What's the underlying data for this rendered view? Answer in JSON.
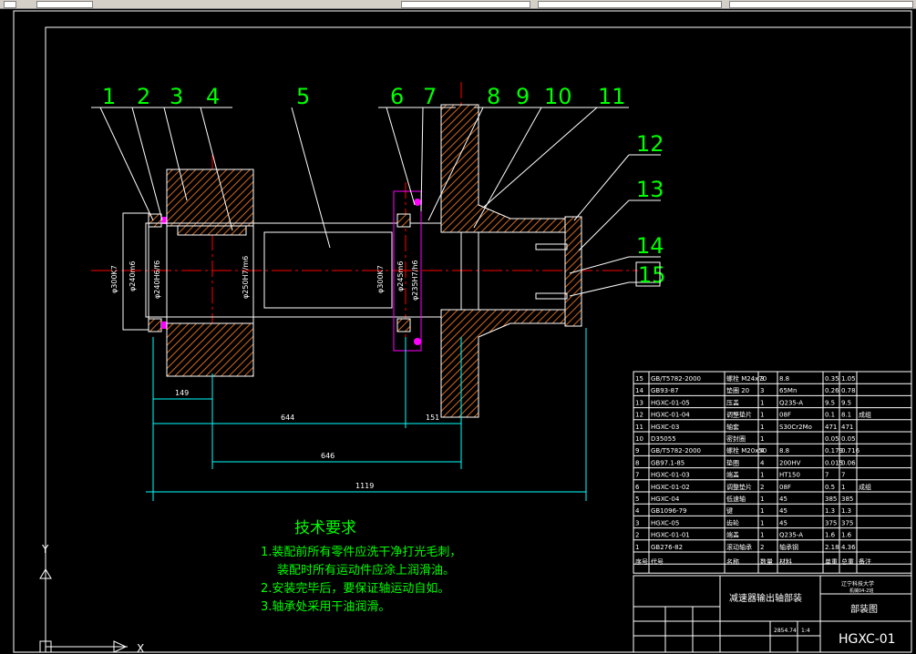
{
  "colors": {
    "background": "#000000",
    "frame": "#ffffff",
    "part_hatch": "#d2691e",
    "part_fill": "#d2691e",
    "centerline": "#ff0000",
    "leader": "#00ffff",
    "balloon": "#00ff00",
    "dim": "#00ffff",
    "seal": "#ff00ff",
    "text": "#00ff00",
    "table": "#ffffff"
  },
  "balloons": [
    "1",
    "2",
    "3",
    "4",
    "5",
    "6",
    "7",
    "8",
    "9",
    "10",
    "11",
    "12",
    "13",
    "14",
    "15"
  ],
  "fit_labels": {
    "d1": "φ300K7",
    "d2": "φ240m6",
    "d3": "φ240H6/f6",
    "d4": "φ250H7/m6",
    "d5": "φ300K7",
    "d6": "φ245m6",
    "d7": "φ235H7/h6"
  },
  "dimensions": {
    "d149": "149",
    "d644": "644",
    "d151": "151",
    "d646": "646",
    "d1119": "1119"
  },
  "notes": {
    "title": "技术要求",
    "line1": "1.装配前所有零件应洗干净打光毛刺，",
    "line2": "装配时所有运动件应涂上润滑油。",
    "line3": "2.安装完毕后，要保证轴运动自如。",
    "line4": "3.轴承处采用干油润滑。"
  },
  "bom": [
    [
      "15",
      "GB/T5782-2000",
      "螺栓 M24x70",
      "3",
      "8.8",
      "0.35",
      "1.05",
      ""
    ],
    [
      "14",
      "GB93-87",
      "垫圈 20",
      "3",
      "65Mn",
      "0.26",
      "0.78",
      ""
    ],
    [
      "13",
      "HGXC-01-05",
      "压盖",
      "1",
      "Q235-A",
      "9.5",
      "9.5",
      ""
    ],
    [
      "12",
      "HGXC-01-04",
      "调整垫片",
      "1",
      "08F",
      "0.1",
      "8.1",
      "成组"
    ],
    [
      "11",
      "HGXC-03",
      "轴套",
      "1",
      "S30Cr2Mo",
      "471",
      "471",
      ""
    ],
    [
      "10",
      "D35055",
      "密封圈",
      "1",
      "",
      "0.05",
      "0.05",
      ""
    ],
    [
      "9",
      "GB/T5782-2000",
      "螺栓 M20x50",
      "4",
      "8.8",
      "0.179",
      "0.716",
      ""
    ],
    [
      "8",
      "GB97.1-85",
      "垫圈",
      "4",
      "200HV",
      "0.015",
      "0.06",
      ""
    ],
    [
      "7",
      "HGXC-01-03",
      "端盖",
      "1",
      "HT150",
      "7",
      "7",
      ""
    ],
    [
      "6",
      "HGXC-01-02",
      "调整垫片",
      "2",
      "08F",
      "0.5",
      "1",
      "成组"
    ],
    [
      "5",
      "HGXC-04",
      "低速轴",
      "1",
      "45",
      "385",
      "385",
      ""
    ],
    [
      "4",
      "GB1096-79",
      "键",
      "1",
      "45",
      "1.3",
      "1.3",
      ""
    ],
    [
      "3",
      "HGXC-05",
      "齿轮",
      "1",
      "45",
      "375",
      "375",
      ""
    ],
    [
      "2",
      "HGXC-01-01",
      "端盖",
      "1",
      "Q235-A",
      "1.6",
      "1.6",
      ""
    ],
    [
      "1",
      "GB276-82",
      "滚动轴承",
      "2",
      "轴承钢",
      "2.18",
      "4.36",
      ""
    ]
  ],
  "bom_header": [
    "序号",
    "代号",
    "名称",
    "数量",
    "材料",
    "单重",
    "总重",
    "备注"
  ],
  "title_block": {
    "drawing_name": "减速器输出轴部装",
    "school": "辽宁科技大学",
    "school_sub": "机械04-2班",
    "sheet_type": "部装图",
    "drawing_no": "HGXC-01",
    "weight": "2854.74",
    "scale": "1:4"
  },
  "ucs": {
    "y": "Y",
    "x": "X"
  }
}
